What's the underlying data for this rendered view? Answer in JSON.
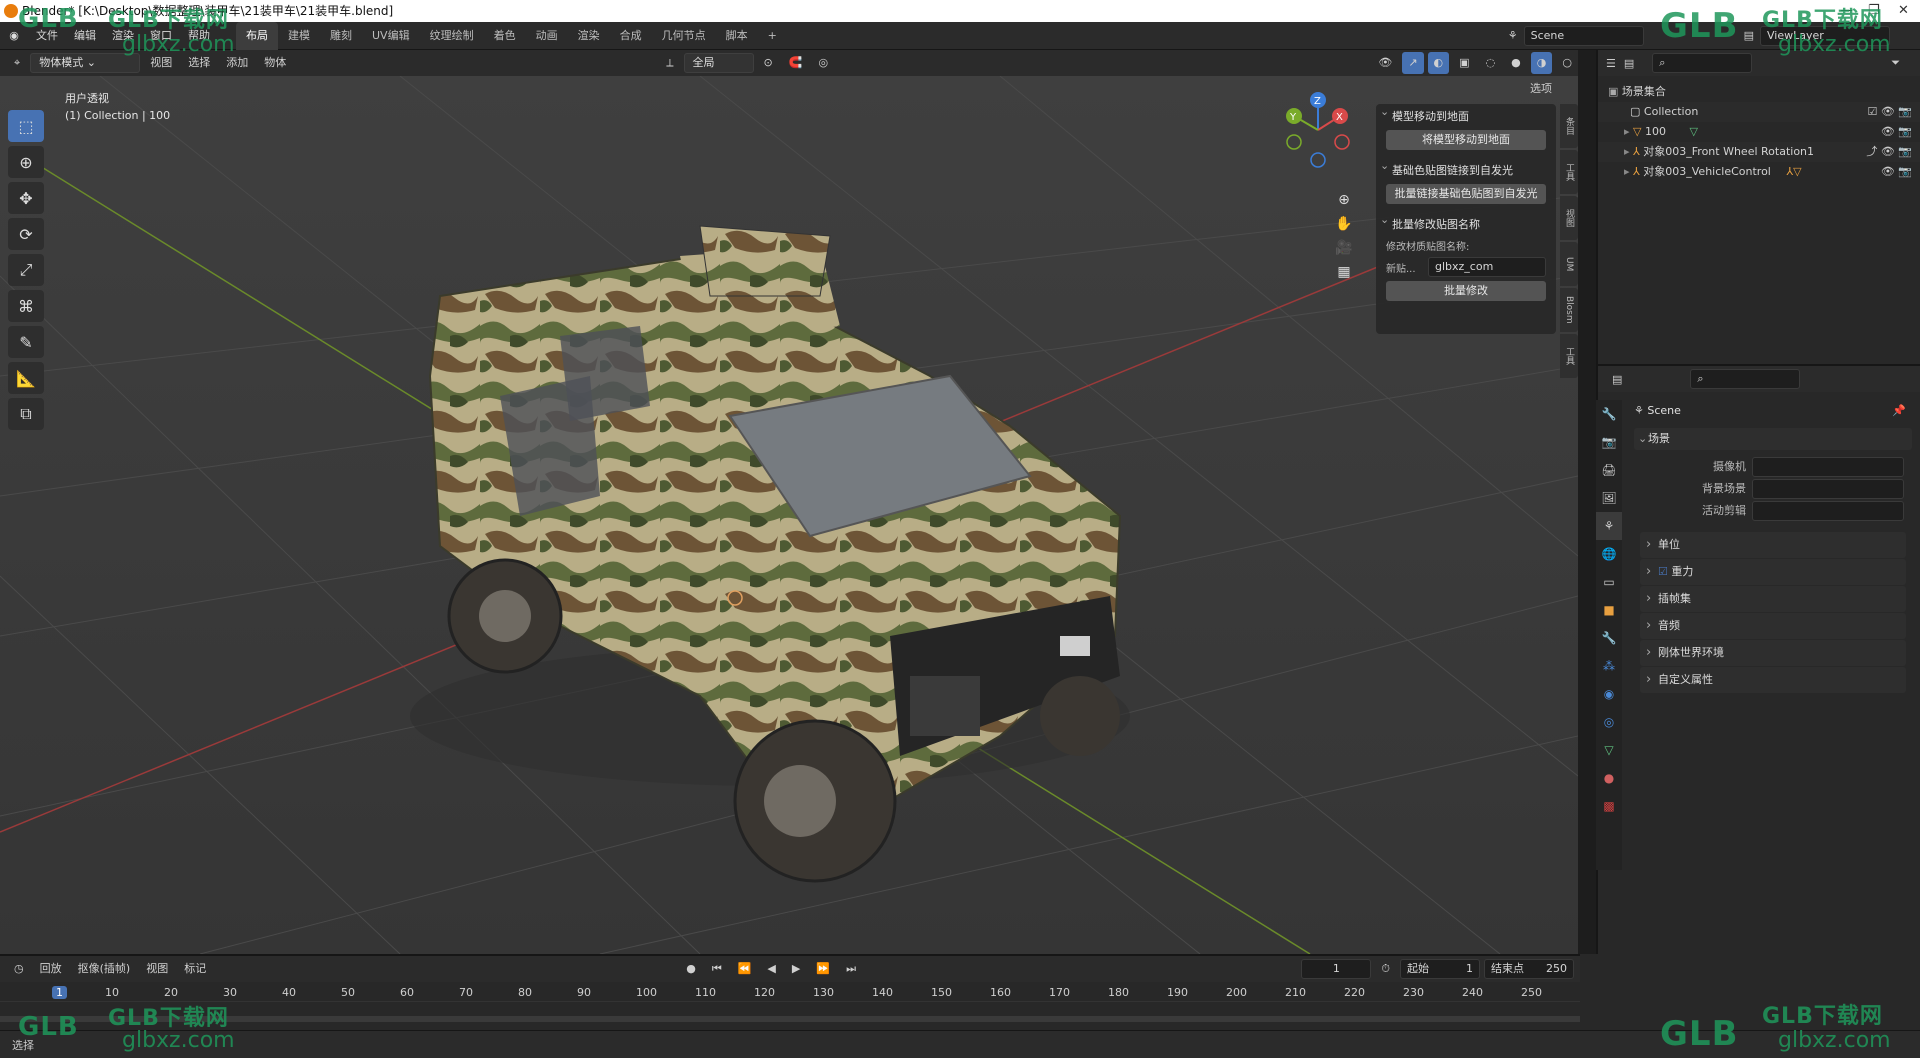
{
  "titlebar": {
    "title": "Blender* [K:\\Desktop\\数据整理\\装甲车\\21装甲车\\21装甲车.blend]",
    "minimize": "—",
    "maximize": "❐",
    "close": "✕"
  },
  "menu": [
    "文件",
    "编辑",
    "渲染",
    "窗口",
    "帮助"
  ],
  "workspaces": [
    "布局",
    "建模",
    "雕刻",
    "UV编辑",
    "纹理绘制",
    "着色",
    "动画",
    "渲染",
    "合成",
    "几何节点",
    "脚本",
    "+"
  ],
  "scene": {
    "label": "Scene",
    "viewlayer": "ViewLayer"
  },
  "viewport_header": {
    "mode": "物体模式",
    "items": [
      "视图",
      "选择",
      "添加",
      "物体"
    ],
    "transform": "全局",
    "options": "选项"
  },
  "viewport_info": {
    "line1": "用户透视",
    "line2": "(1) Collection | 100"
  },
  "gizmo": {
    "x": "X",
    "y": "Y",
    "z": "Z"
  },
  "npanel": {
    "section1": "模型移动到地面",
    "btn1": "将模型移动到地面",
    "section2": "基础色贴图链接到自发光",
    "btn2": "批量链接基础色贴图到自发光",
    "section3": "批量修改贴图名称",
    "label3": "修改材质贴图名称:",
    "field_label": "新贴...",
    "field_value": "glbxz_com",
    "btn3": "批量修改"
  },
  "side_tabs": [
    "条目",
    "工具",
    "视图",
    "UM",
    "Blosm",
    "工具"
  ],
  "outliner": {
    "header": "场景集合",
    "rows": [
      {
        "name": "Collection"
      },
      {
        "name": "100"
      },
      {
        "name": "对象003_Front Wheel Rotation1"
      },
      {
        "name": "对象003_VehicleControl"
      }
    ]
  },
  "properties": {
    "search_placeholder": "",
    "scene_name": "Scene",
    "panel": "场景",
    "fields": [
      {
        "label": "摄像机",
        "value": ""
      },
      {
        "label": "背景场景",
        "value": ""
      },
      {
        "label": "活动剪辑",
        "value": ""
      }
    ],
    "sections": [
      "单位",
      "重力",
      "插帧集",
      "音频",
      "刚体世界环境",
      "自定义属性"
    ]
  },
  "timeline": {
    "items": [
      "回放",
      "抠像(插帧)",
      "视图",
      "标记"
    ],
    "current_frame": "1",
    "start_label": "起始",
    "start": "1",
    "end_label": "结束点",
    "end": "250",
    "ticks": [
      "1",
      "10",
      "20",
      "30",
      "40",
      "50",
      "60",
      "70",
      "80",
      "90",
      "100",
      "110",
      "120",
      "130",
      "140",
      "150",
      "160",
      "170",
      "180",
      "190",
      "200",
      "210",
      "220",
      "230",
      "240",
      "250"
    ]
  },
  "status": {
    "left": "选择"
  },
  "watermark": {
    "brand": "GLB下载网",
    "url": "glbxz.com",
    "logo": "GLB"
  }
}
